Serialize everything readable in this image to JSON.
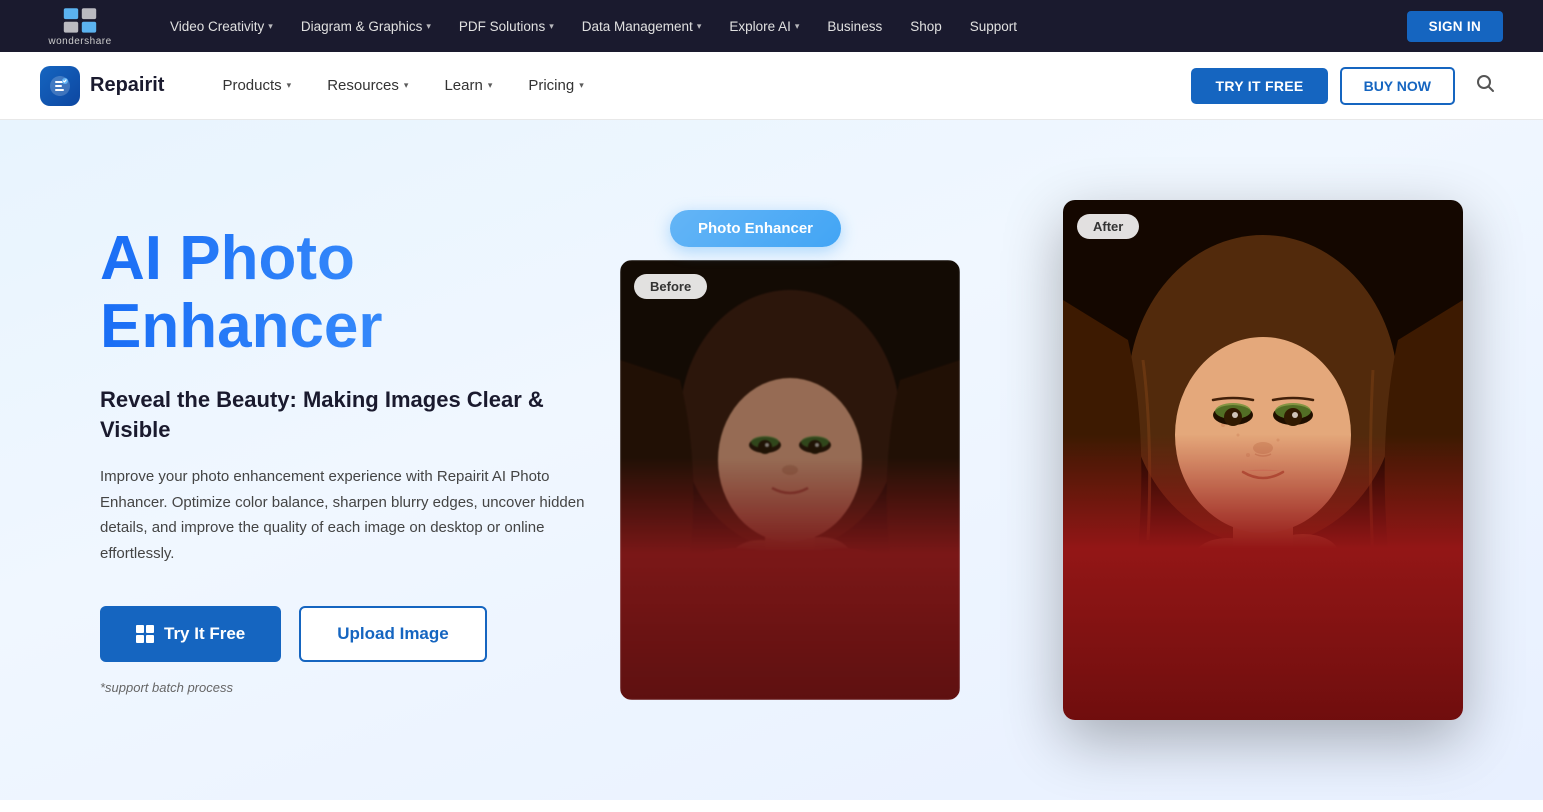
{
  "top_nav": {
    "logo_text": "wondershare",
    "items": [
      {
        "label": "Video Creativity",
        "has_dropdown": true
      },
      {
        "label": "Diagram & Graphics",
        "has_dropdown": true
      },
      {
        "label": "PDF Solutions",
        "has_dropdown": true
      },
      {
        "label": "Data Management",
        "has_dropdown": true
      },
      {
        "label": "Explore AI",
        "has_dropdown": true
      },
      {
        "label": "Business",
        "has_dropdown": false
      },
      {
        "label": "Shop",
        "has_dropdown": false
      },
      {
        "label": "Support",
        "has_dropdown": false
      }
    ],
    "sign_in_label": "SIGN IN"
  },
  "second_nav": {
    "brand_name": "Repairit",
    "items": [
      {
        "label": "Products",
        "has_dropdown": true
      },
      {
        "label": "Resources",
        "has_dropdown": true
      },
      {
        "label": "Learn",
        "has_dropdown": true
      },
      {
        "label": "Pricing",
        "has_dropdown": true
      }
    ],
    "try_free_label": "TRY IT FREE",
    "buy_now_label": "BUY NOW"
  },
  "hero": {
    "title": "AI Photo Enhancer",
    "subtitle": "Reveal the Beauty: Making Images Clear & Visible",
    "description": "Improve your photo enhancement experience with Repairit AI Photo Enhancer. Optimize color balance, sharpen blurry edges, uncover hidden details, and improve the quality of each image on desktop or online effortlessly.",
    "try_btn_label": "Try It Free",
    "upload_btn_label": "Upload Image",
    "note": "*support batch process",
    "photo_enhancer_bubble": "Photo Enhancer",
    "before_label": "Before",
    "after_label": "After"
  }
}
